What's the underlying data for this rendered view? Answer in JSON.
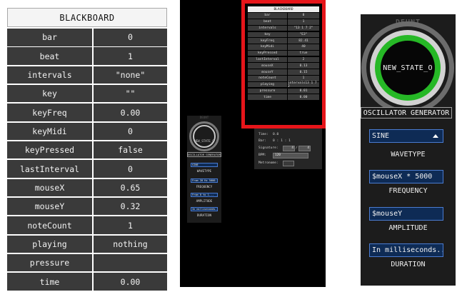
{
  "blackboard": {
    "title": "BLACKBOARD",
    "rows": [
      {
        "key": "bar",
        "value": "0"
      },
      {
        "key": "beat",
        "value": "1"
      },
      {
        "key": "intervals",
        "value": "\"none\""
      },
      {
        "key": "key",
        "value": "\"\""
      },
      {
        "key": "keyFreq",
        "value": "0.00"
      },
      {
        "key": "keyMidi",
        "value": "0"
      },
      {
        "key": "keyPressed",
        "value": "false"
      },
      {
        "key": "lastInterval",
        "value": "0"
      },
      {
        "key": "mouseX",
        "value": "0.65"
      },
      {
        "key": "mouseY",
        "value": "0.32"
      },
      {
        "key": "noteCount",
        "value": "1"
      },
      {
        "key": "playing",
        "value": "nothing"
      },
      {
        "key": "pressure",
        "value": ""
      },
      {
        "key": "time",
        "value": "0.00"
      }
    ]
  },
  "mini_blackboard": {
    "title": "BLACKBOARD",
    "highlight_color": "#e6151a",
    "rows": [
      {
        "key": "bar",
        "value": "0"
      },
      {
        "key": "beat",
        "value": "1"
      },
      {
        "key": "intervals",
        "value": "\"13 1 7 2\""
      },
      {
        "key": "key",
        "value": "\"E3\""
      },
      {
        "key": "keyFreq",
        "value": "82.41"
      },
      {
        "key": "keyMidi",
        "value": "40"
      },
      {
        "key": "keyPressed",
        "value": "true"
      },
      {
        "key": "lastInterval",
        "value": "2"
      },
      {
        "key": "mouseX",
        "value": "0.13"
      },
      {
        "key": "mouseY",
        "value": "0.15"
      },
      {
        "key": "noteCount",
        "value": "1"
      },
      {
        "key": "playing",
        "value": "intervals13 1 7 2"
      },
      {
        "key": "pressure",
        "value": "0.01"
      },
      {
        "key": "time",
        "value": "0.00"
      }
    ]
  },
  "transport": {
    "time_label": "Time:",
    "time_value": "0.0",
    "bar_label": "Bar:",
    "bar_value": "0 : 1 : 1",
    "signature_label": "Signature:",
    "signature_num": "4",
    "signature_den": "4",
    "bpm_label": "BPM:",
    "bpm_value": "120",
    "metronome_label": "Metronome:"
  },
  "mini_oscillator": {
    "top_label": "DEUNT",
    "state": "NEW_STATE_O",
    "title": "OSCILLATOR GENERATOR",
    "wavetype_value": "SINE",
    "wavetype_label": "WAVETYPE",
    "frequency_value": "From 20 Hz 5000...",
    "frequency_label": "FREQUENCY",
    "amplitude_value": "From 0 to 1...",
    "amplitude_label": "AMPLITUDE",
    "duration_value": "In milliseconds...",
    "duration_label": "DURATION"
  },
  "oscillator": {
    "top_label": "DEUNT",
    "state": "NEW_STATE_O",
    "title": "OSCILLATOR GENERATOR",
    "wavetype_value": "SINE",
    "wavetype_label": "WAVETYPE",
    "frequency_value": "$mouseX * 5000",
    "frequency_label": "FREQUENCY",
    "amplitude_value": "$mouseY",
    "amplitude_label": "AMPLITUDE",
    "duration_value": "In milliseconds...",
    "duration_label": "DURATION",
    "icons": {
      "dropdown": "chevron-up-icon"
    },
    "colors": {
      "ring_green": "#26b826",
      "field_bg": "#0e2b55",
      "field_border": "#4a7bd0"
    }
  }
}
